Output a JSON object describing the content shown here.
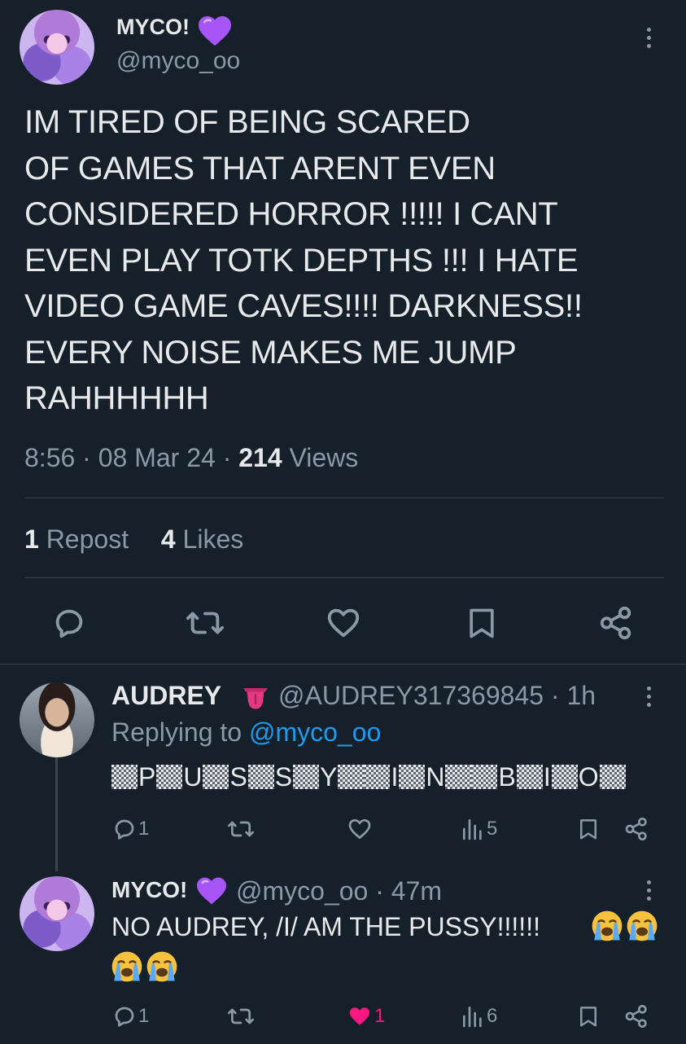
{
  "main_tweet": {
    "display_name": "MYCO!",
    "badge_icon": "purple-heart-emoji",
    "handle": "@myco_oo",
    "text_lines": [
      "IM TIRED OF BEING SCARED",
      "OF GAMES THAT ARENT EVEN",
      "CONSIDERED HORROR !!!!! I CANT",
      "EVEN PLAY TOTK DEPTHS !!! I HATE",
      "VIDEO GAME CAVES!!!! DARKNESS!!",
      "EVERY NOISE MAKES ME JUMP",
      "RAHHHHHH"
    ],
    "time": "8:56",
    "date": "08 Mar 24",
    "views_count": "214",
    "views_label": "Views",
    "repost_count": "1",
    "repost_label": "Repost",
    "likes_count": "4",
    "likes_label": "Likes"
  },
  "reply1": {
    "display_name": "AUDREY",
    "badge_icon": "tongue-emoji",
    "handle": "@AUDREY317369845",
    "time": "1h",
    "replying_prefix": "Replying to",
    "replying_handle": "@myco_oo",
    "censored_letters": [
      "P",
      "U",
      "S",
      "S",
      "Y",
      "",
      "I",
      "N",
      "",
      "B",
      "I",
      "O"
    ],
    "reply_count": "1",
    "views_count": "5"
  },
  "reply2": {
    "display_name": "MYCO!",
    "badge_icon": "purple-heart-emoji",
    "handle": "@myco_oo",
    "time": "47m",
    "text_line1": "NO AUDREY, /I/ AM THE PUSSY!!!!!!",
    "emojis": [
      "loudly-crying-face",
      "loudly-crying-face",
      "loudly-crying-face",
      "loudly-crying-face"
    ],
    "reply_count": "1",
    "like_count": "1",
    "views_count": "6"
  },
  "colors": {
    "background": "#15202b",
    "text": "#e7e9ea",
    "muted": "#8b98a5",
    "link": "#1d9bf0",
    "liked": "#f91880",
    "divider": "#38444d"
  }
}
